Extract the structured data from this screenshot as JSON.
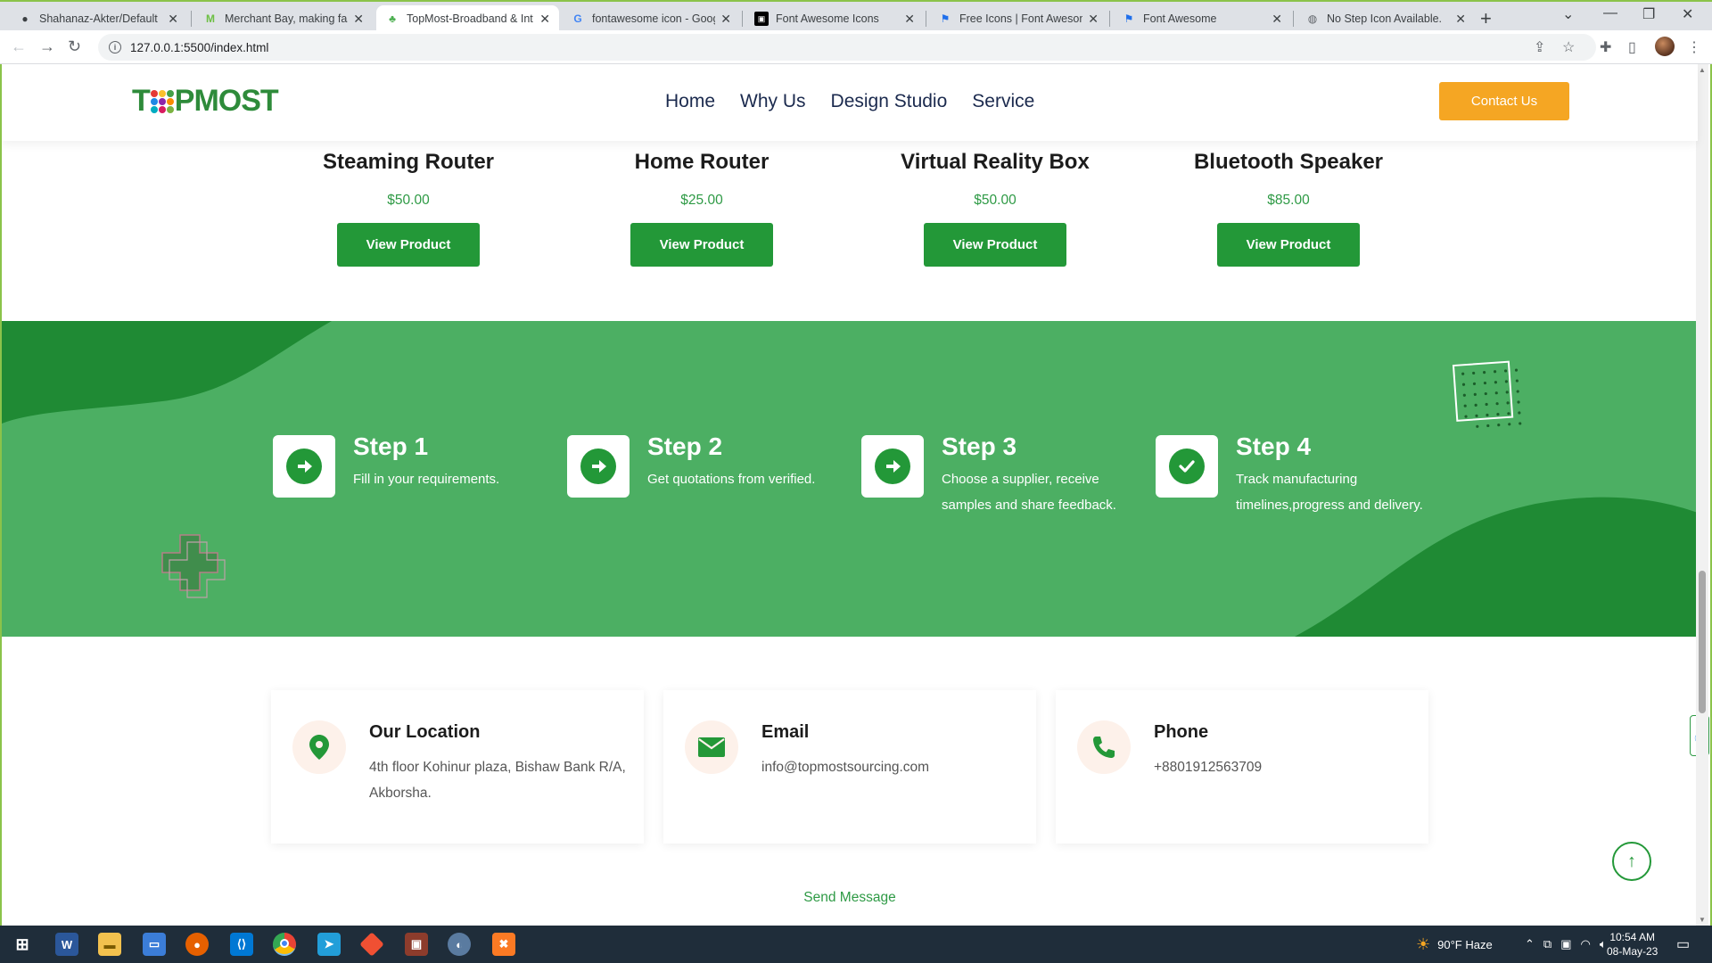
{
  "browser": {
    "tabs": [
      {
        "title": "Shahanaz-Akter/Default",
        "icon": "github-icon"
      },
      {
        "title": "Merchant Bay, making fash",
        "icon": "merchant-bay-icon"
      },
      {
        "title": "TopMost-Broadband & Int",
        "icon": "topmost-icon",
        "active": true
      },
      {
        "title": "fontawesome icon - Googl",
        "icon": "google-icon"
      },
      {
        "title": "Font Awesome Icons",
        "icon": "w3schools-icon"
      },
      {
        "title": "Free Icons | Font Awesome",
        "icon": "flag-icon"
      },
      {
        "title": "Font Awesome",
        "icon": "flag-icon"
      },
      {
        "title": "No Step Icon Available.",
        "icon": "globe-icon"
      }
    ],
    "url": "127.0.0.1:5500/index.html"
  },
  "header": {
    "logo": "TOPMOST",
    "nav": [
      "Home",
      "Why Us",
      "Design Studio",
      "Service"
    ],
    "contact_label": "Contact Us"
  },
  "products": [
    {
      "name": "Steaming Router",
      "price": "$50.00",
      "button": "View Product"
    },
    {
      "name": "Home Router",
      "price": "$25.00",
      "button": "View Product"
    },
    {
      "name": "Virtual Reality Box",
      "price": "$50.00",
      "button": "View Product"
    },
    {
      "name": "Bluetooth Speaker",
      "price": "$85.00",
      "button": "View Product"
    }
  ],
  "steps": [
    {
      "title": "Step 1",
      "desc": "Fill in your requirements.",
      "icon": "arrow-right-circle-icon"
    },
    {
      "title": "Step 2",
      "desc": "Get quotations from verified.",
      "icon": "arrow-right-circle-icon"
    },
    {
      "title": "Step 3",
      "desc": "Choose a supplier, receive samples and share feedback.",
      "icon": "arrow-right-circle-icon"
    },
    {
      "title": "Step 4",
      "desc": "Track manufacturing timelines,progress and delivery.",
      "icon": "check-circle-icon"
    }
  ],
  "contact": [
    {
      "title": "Our Location",
      "value": "4th floor Kohinur plaza, Bishaw Bank R/A, Akborsha.",
      "icon": "map-marker-icon"
    },
    {
      "title": "Email",
      "value": "info@topmostsourcing.com",
      "icon": "envelope-icon"
    },
    {
      "title": "Phone",
      "value": "+8801912563709",
      "icon": "phone-icon"
    }
  ],
  "send_message": "Send Message",
  "taskbar": {
    "weather": "90°F  Haze",
    "time": "10:54 AM",
    "date": "08-May-23"
  },
  "colors": {
    "brand_green": "#239838",
    "band_green": "#4caf63",
    "accent_orange": "#f5a623"
  }
}
